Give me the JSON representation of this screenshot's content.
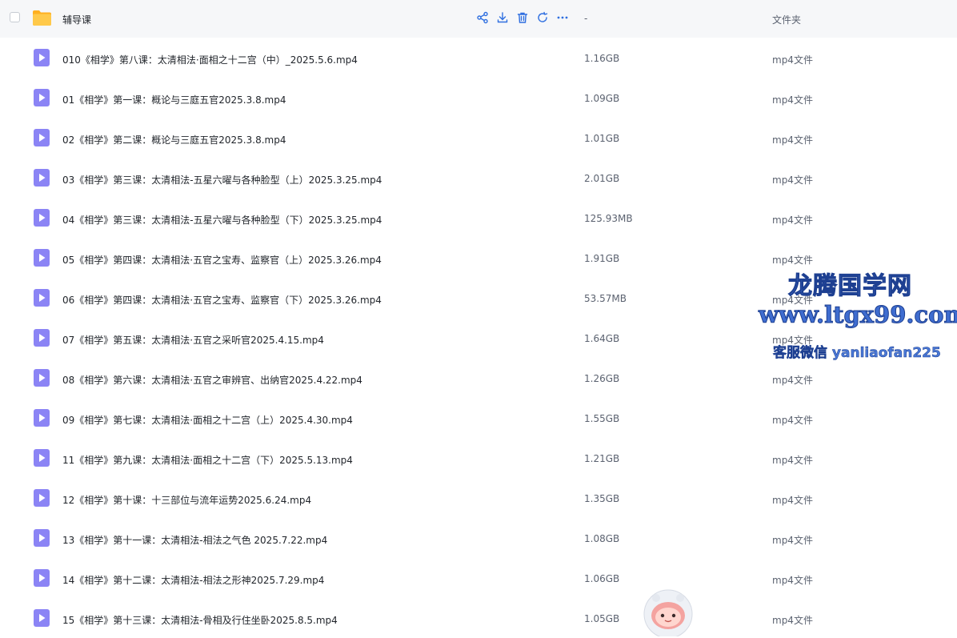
{
  "folder": {
    "name": "辅导课",
    "size": "-",
    "type": "文件夹",
    "actions": [
      {
        "icon": "share-icon"
      },
      {
        "icon": "download-icon"
      },
      {
        "icon": "delete-icon"
      },
      {
        "icon": "refresh-icon"
      },
      {
        "icon": "more-icon"
      }
    ]
  },
  "files": [
    {
      "name": "010《相学》第八课：太清相法·面相之十二宫（中）_2025.5.6.mp4",
      "size": "1.16GB",
      "type": "mp4文件"
    },
    {
      "name": "01《相学》第一课：概论与三庭五官2025.3.8.mp4",
      "size": "1.09GB",
      "type": "mp4文件"
    },
    {
      "name": "02《相学》第二课：概论与三庭五官2025.3.8.mp4",
      "size": "1.01GB",
      "type": "mp4文件"
    },
    {
      "name": "03《相学》第三课：太清相法-五星六曜与各种脸型（上）2025.3.25.mp4",
      "size": "2.01GB",
      "type": "mp4文件"
    },
    {
      "name": "04《相学》第三课：太清相法-五星六曜与各种脸型（下）2025.3.25.mp4",
      "size": "125.93MB",
      "type": "mp4文件"
    },
    {
      "name": "05《相学》第四课：太清相法·五官之宝寿、监察官（上）2025.3.26.mp4",
      "size": "1.91GB",
      "type": "mp4文件"
    },
    {
      "name": "06《相学》第四课：太清相法·五官之宝寿、监察官（下）2025.3.26.mp4",
      "size": "53.57MB",
      "type": "mp4文件"
    },
    {
      "name": "07《相学》第五课：太清相法·五官之采听官2025.4.15.mp4",
      "size": "1.64GB",
      "type": "mp4文件"
    },
    {
      "name": "08《相学》第六课：太清相法·五官之审辨官、出纳官2025.4.22.mp4",
      "size": "1.26GB",
      "type": "mp4文件"
    },
    {
      "name": "09《相学》第七课：太清相法·面相之十二宫（上）2025.4.30.mp4",
      "size": "1.55GB",
      "type": "mp4文件"
    },
    {
      "name": "11《相学》第九课：太清相法·面相之十二宫（下）2025.5.13.mp4",
      "size": "1.21GB",
      "type": "mp4文件"
    },
    {
      "name": "12《相学》第十课：十三部位与流年运势2025.6.24.mp4",
      "size": "1.35GB",
      "type": "mp4文件"
    },
    {
      "name": "13《相学》第十一课：太清相法-相法之气色 2025.7.22.mp4",
      "size": "1.08GB",
      "type": "mp4文件"
    },
    {
      "name": "14《相学》第十二课：太清相法-相法之形神2025.7.29.mp4",
      "size": "1.06GB",
      "type": "mp4文件"
    },
    {
      "name": "15《相学》第十三课：太清相法-骨相及行住坐卧2025.8.5.mp4",
      "size": "1.05GB",
      "type": "mp4文件"
    }
  ],
  "watermark": {
    "line1": "龙腾国学网",
    "line2": "www.ltgx99.com",
    "line3": "客服微信 yanliaofan225"
  },
  "colors": {
    "accent": "#2f6fe0",
    "video_icon": "#8b84f5",
    "folder_icon": "#ffc23d",
    "header_bg": "#f6f7f9"
  }
}
